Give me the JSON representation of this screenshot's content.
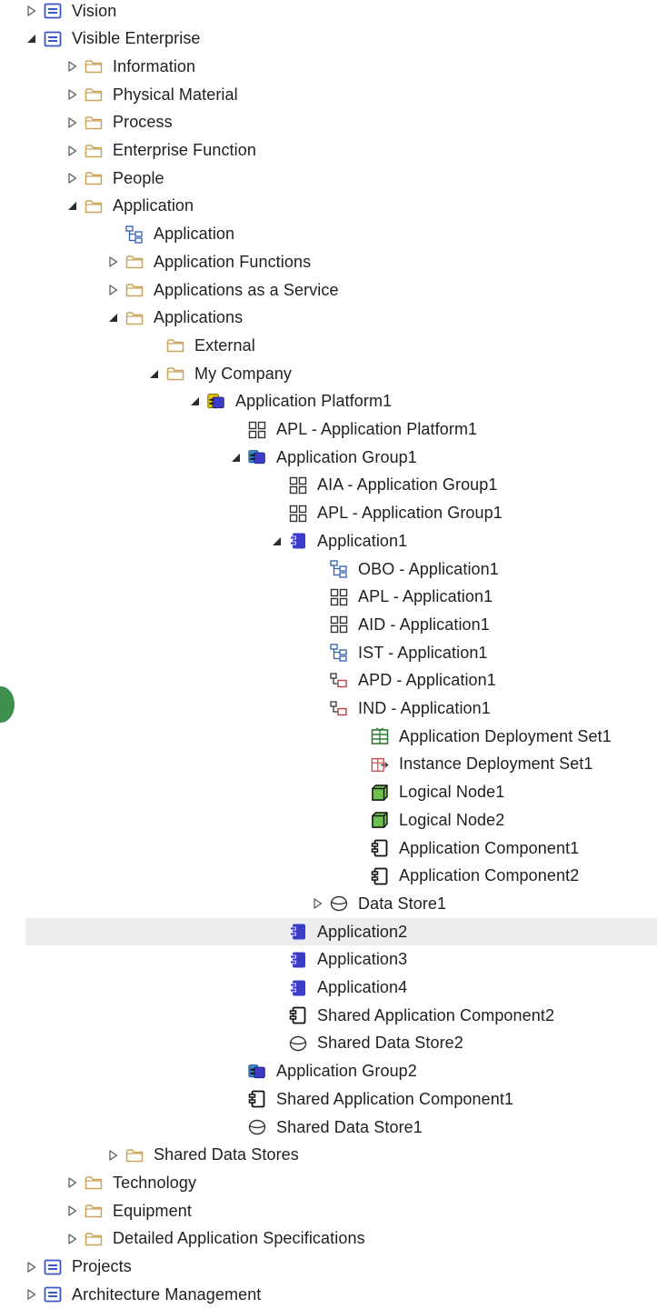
{
  "tree": [
    {
      "label": "Vision",
      "depth": 0,
      "state": "collapsed",
      "icon": "package-icon"
    },
    {
      "label": "Visible Enterprise",
      "depth": 0,
      "state": "expanded",
      "icon": "package-icon"
    },
    {
      "label": "Information",
      "depth": 1,
      "state": "collapsed",
      "icon": "folder-icon"
    },
    {
      "label": "Physical Material",
      "depth": 1,
      "state": "collapsed",
      "icon": "folder-icon"
    },
    {
      "label": "Process",
      "depth": 1,
      "state": "collapsed",
      "icon": "folder-icon"
    },
    {
      "label": "Enterprise Function",
      "depth": 1,
      "state": "collapsed",
      "icon": "folder-icon"
    },
    {
      "label": "People",
      "depth": 1,
      "state": "collapsed",
      "icon": "folder-icon"
    },
    {
      "label": "Application",
      "depth": 1,
      "state": "expanded",
      "icon": "folder-icon"
    },
    {
      "label": "Application",
      "depth": 2,
      "state": "none",
      "icon": "diagram-hierarchy-icon"
    },
    {
      "label": "Application Functions",
      "depth": 2,
      "state": "collapsed",
      "icon": "folder-icon"
    },
    {
      "label": "Applications as a Service",
      "depth": 2,
      "state": "collapsed",
      "icon": "folder-icon"
    },
    {
      "label": "Applications",
      "depth": 2,
      "state": "expanded",
      "icon": "folder-icon"
    },
    {
      "label": "External",
      "depth": 3,
      "state": "none",
      "icon": "folder-icon"
    },
    {
      "label": "My Company",
      "depth": 3,
      "state": "expanded",
      "icon": "folder-icon"
    },
    {
      "label": "Application Platform1",
      "depth": 4,
      "state": "expanded",
      "icon": "application-platform-icon"
    },
    {
      "label": "APL - Application Platform1",
      "depth": 5,
      "state": "none",
      "icon": "diagram-grid-icon"
    },
    {
      "label": "Application Group1",
      "depth": 5,
      "state": "expanded",
      "icon": "application-group-icon"
    },
    {
      "label": "AIA - Application Group1",
      "depth": 6,
      "state": "none",
      "icon": "diagram-grid-icon"
    },
    {
      "label": "APL - Application Group1",
      "depth": 6,
      "state": "none",
      "icon": "diagram-grid-icon"
    },
    {
      "label": "Application1",
      "depth": 6,
      "state": "expanded",
      "icon": "application-icon"
    },
    {
      "label": "OBO - Application1",
      "depth": 7,
      "state": "none",
      "icon": "diagram-hierarchy-icon"
    },
    {
      "label": "APL - Application1",
      "depth": 7,
      "state": "none",
      "icon": "diagram-grid-icon"
    },
    {
      "label": "AID - Application1",
      "depth": 7,
      "state": "none",
      "icon": "diagram-grid-icon"
    },
    {
      "label": "IST - Application1",
      "depth": 7,
      "state": "none",
      "icon": "diagram-hierarchy-icon"
    },
    {
      "label": "APD - Application1",
      "depth": 7,
      "state": "none",
      "icon": "diagram-deployment-icon"
    },
    {
      "label": "IND - Application1",
      "depth": 7,
      "state": "none",
      "icon": "diagram-deployment-icon"
    },
    {
      "label": "Application Deployment Set1",
      "depth": 8,
      "state": "none",
      "icon": "deployment-set-icon"
    },
    {
      "label": "Instance Deployment Set1",
      "depth": 8,
      "state": "none",
      "icon": "instance-deployment-set-icon"
    },
    {
      "label": "Logical Node1",
      "depth": 8,
      "state": "none",
      "icon": "logical-node-icon"
    },
    {
      "label": "Logical Node2",
      "depth": 8,
      "state": "none",
      "icon": "logical-node-icon"
    },
    {
      "label": "Application Component1",
      "depth": 8,
      "state": "none",
      "icon": "application-component-icon"
    },
    {
      "label": "Application Component2",
      "depth": 8,
      "state": "none",
      "icon": "application-component-icon"
    },
    {
      "label": "Data Store1",
      "depth": 7,
      "state": "collapsed",
      "icon": "data-store-icon"
    },
    {
      "label": "Application2",
      "depth": 6,
      "state": "none",
      "icon": "application-icon",
      "selected": true
    },
    {
      "label": "Application3",
      "depth": 6,
      "state": "none",
      "icon": "application-icon"
    },
    {
      "label": "Application4",
      "depth": 6,
      "state": "none",
      "icon": "application-icon"
    },
    {
      "label": "Shared Application Component2",
      "depth": 6,
      "state": "none",
      "icon": "application-component-icon"
    },
    {
      "label": "Shared Data Store2",
      "depth": 6,
      "state": "none",
      "icon": "data-store-icon"
    },
    {
      "label": "Application Group2",
      "depth": 5,
      "state": "none",
      "icon": "application-group-icon"
    },
    {
      "label": "Shared Application Component1",
      "depth": 5,
      "state": "none",
      "icon": "application-component-icon"
    },
    {
      "label": "Shared Data Store1",
      "depth": 5,
      "state": "none",
      "icon": "data-store-icon"
    },
    {
      "label": "Shared Data Stores",
      "depth": 2,
      "state": "collapsed",
      "icon": "folder-icon"
    },
    {
      "label": "Technology",
      "depth": 1,
      "state": "collapsed",
      "icon": "folder-icon"
    },
    {
      "label": "Equipment",
      "depth": 1,
      "state": "collapsed",
      "icon": "folder-icon"
    },
    {
      "label": "Detailed Application Specifications",
      "depth": 1,
      "state": "collapsed",
      "icon": "folder-icon"
    },
    {
      "label": "Projects",
      "depth": 0,
      "state": "collapsed",
      "icon": "package-icon"
    },
    {
      "label": "Architecture Management",
      "depth": 0,
      "state": "collapsed",
      "icon": "package-icon"
    }
  ],
  "colors": {
    "package": "#3a56c8",
    "folder": "#c9a35a",
    "application": "#3c3cc8",
    "platform": "#e6c800",
    "logical_node": "#6cc24a",
    "deployment_set": "#2e7d32",
    "instance_set": "#d04040",
    "selected_row": "#ededed"
  }
}
